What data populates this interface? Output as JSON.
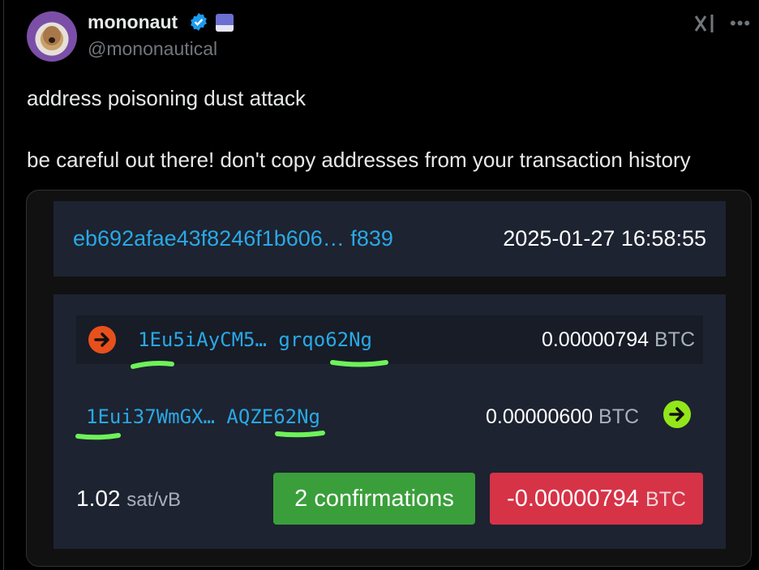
{
  "post": {
    "display_name": "mononaut",
    "handle": "@mononautical",
    "lines": [
      "address poisoning dust attack",
      "be careful out there! don't copy addresses from your transaction history"
    ]
  },
  "icons": [
    "verified-badge-icon",
    "affiliate-flag-icon",
    "grok-icon",
    "more-icon",
    "arrow-right-icon"
  ],
  "colors": {
    "link": "#2aa8e6",
    "input_arrow": "#e8501b",
    "output_arrow": "#93e61a",
    "confirm_bg": "#3a9f3a",
    "negative_bg": "#d63347",
    "highlight": "#6ef25a"
  },
  "tx": {
    "txid": "eb692afae43f8246f1b606… f839",
    "timestamp": "2025-01-27 16:58:55",
    "input": {
      "address": "1Eu5iAyCM5… grqo62Ng",
      "amount": "0.00000794",
      "unit": "BTC"
    },
    "output": {
      "address": "1Eui37WmGX… AQZE62Ng",
      "amount": "0.00000600",
      "unit": "BTC"
    },
    "fee_rate": "1.02",
    "fee_unit": "sat/vB",
    "confirmations": "2 confirmations",
    "net_amount": "-0.00000794",
    "net_unit": "BTC"
  }
}
